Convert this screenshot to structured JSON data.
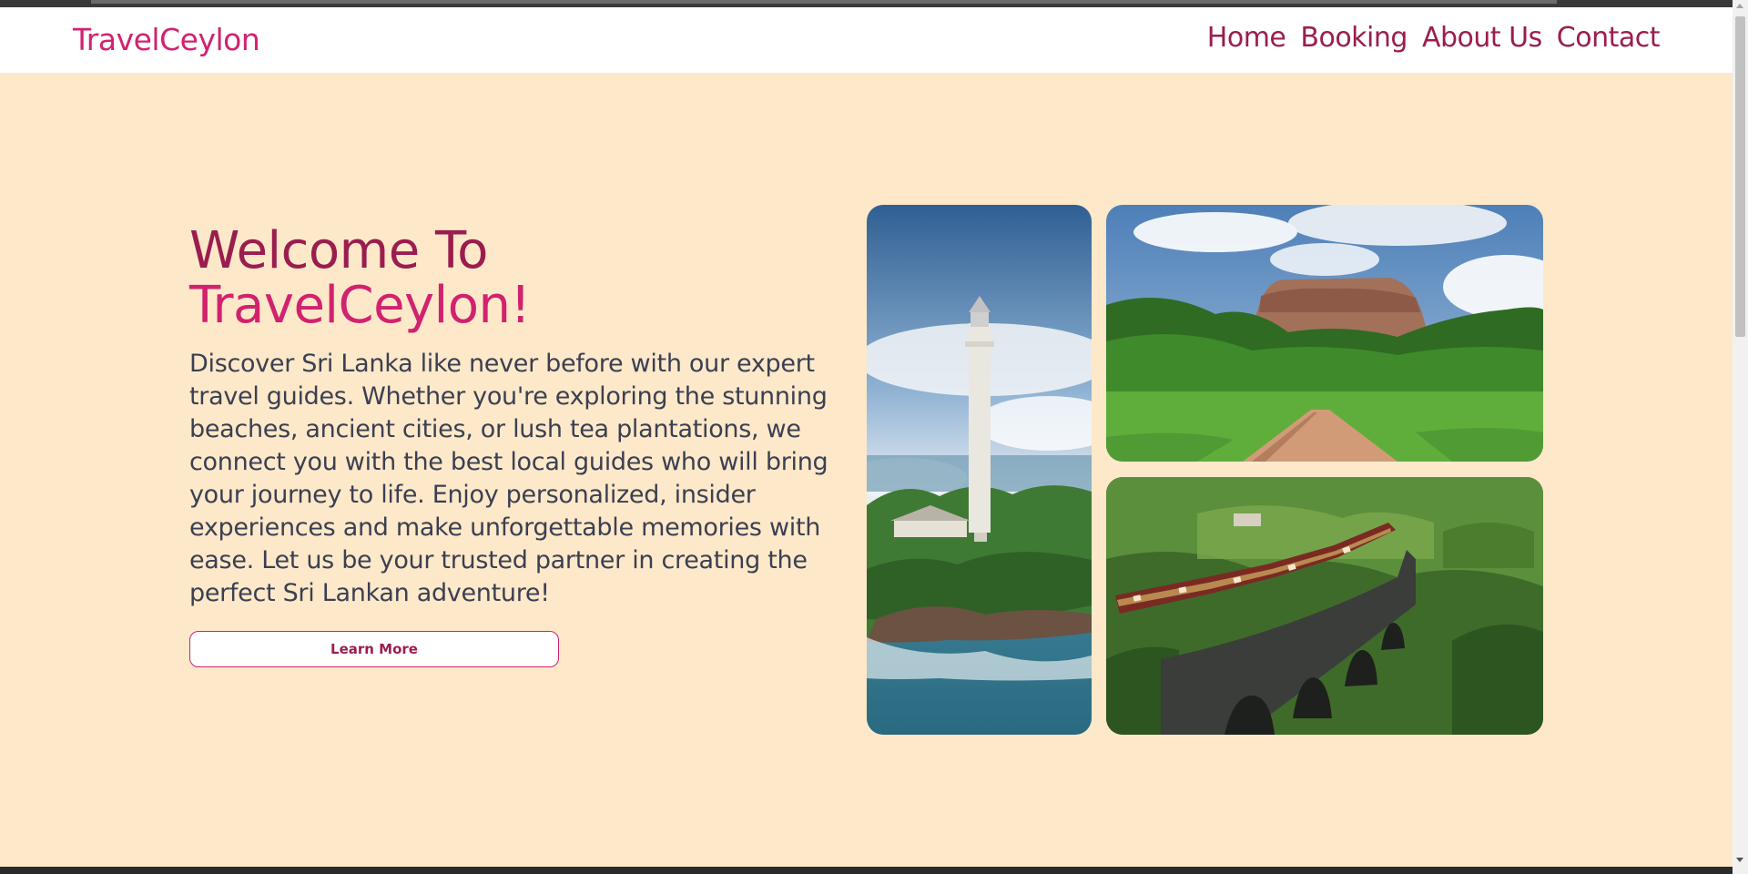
{
  "nav": {
    "brand": "TravelCeylon",
    "links": [
      "Home",
      "Booking",
      "About Us",
      "Contact"
    ]
  },
  "hero": {
    "title_line1": "Welcome To",
    "title_line2": "TravelCeylon!",
    "description": "Discover Sri Lanka like never before with our expert travel guides. Whether you're exploring the stunning beaches, ancient cities, or lush tea plantations, we connect you with the best local guides who will bring your journey to life. Enjoy personalized, insider experiences and make unforgettable memories with ease. Let us be your trusted partner in creating the perfect Sri Lankan adventure!",
    "button_label": "Learn More"
  },
  "colors": {
    "background": "#fde9c9",
    "brand_pink": "#d1226f",
    "nav_maroon": "#9b1d4f",
    "text": "#3b3f52"
  }
}
